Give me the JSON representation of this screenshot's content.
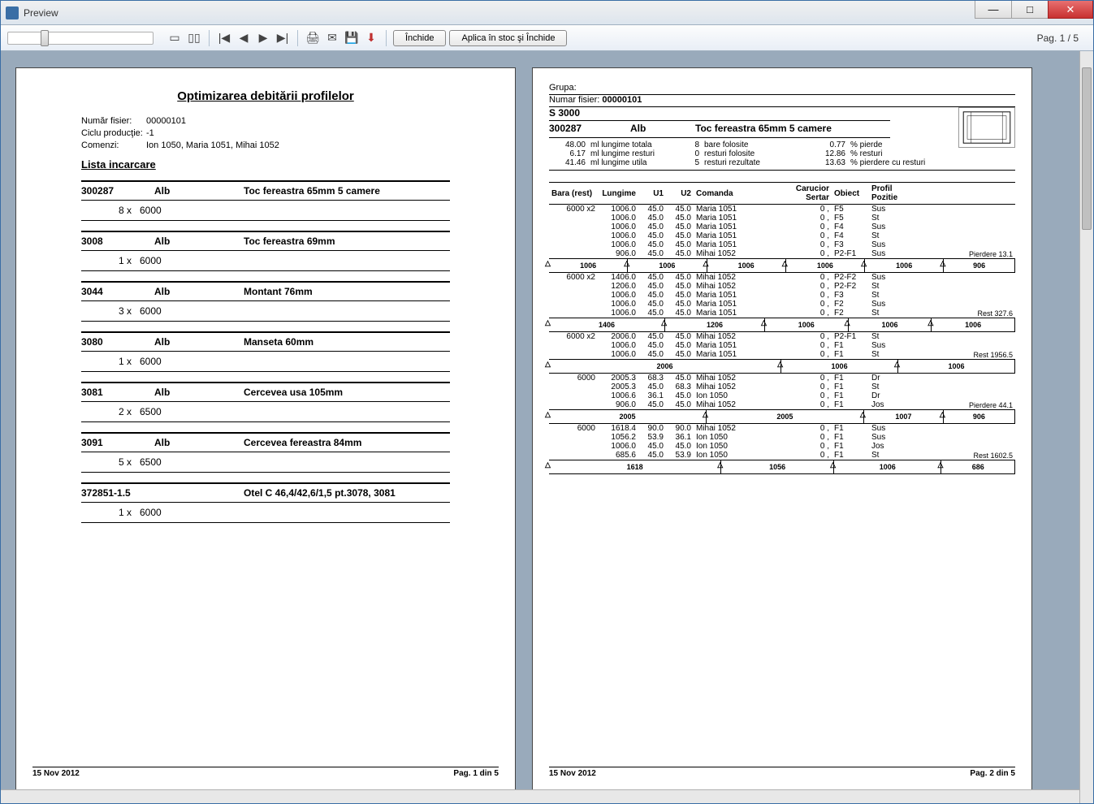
{
  "window": {
    "title": "Preview"
  },
  "toolbar": {
    "close_label": "Închide",
    "apply_label": "Aplica în stoc şi Închide",
    "page_indicator": "Pag. 1 / 5"
  },
  "page1": {
    "title": "Optimizarea debitării profilelor",
    "meta": {
      "file_label": "Număr fisier:",
      "file_value": "00000101",
      "cycle_label": "Ciclu producţie:",
      "cycle_value": "-1",
      "orders_label": "Comenzi:",
      "orders_value": "Ion 1050, Maria 1051, Mihai 1052"
    },
    "list_title": "Lista incarcare",
    "blocks": [
      {
        "code": "300287",
        "color": "Alb",
        "desc": "Toc fereastra 65mm 5 camere",
        "line": "8 x   6000"
      },
      {
        "code": "3008",
        "color": "Alb",
        "desc": "Toc fereastra 69mm",
        "line": "1 x   6000"
      },
      {
        "code": "3044",
        "color": "Alb",
        "desc": "Montant 76mm",
        "line": "3 x   6000"
      },
      {
        "code": "3080",
        "color": "Alb",
        "desc": "Manseta 60mm",
        "line": "1 x   6000"
      },
      {
        "code": "3081",
        "color": "Alb",
        "desc": "Cercevea usa 105mm",
        "line": "2 x   6500"
      },
      {
        "code": "3091",
        "color": "Alb",
        "desc": "Cercevea fereastra 84mm",
        "line": "5 x   6500"
      },
      {
        "code": "372851-1.5",
        "color": "",
        "desc": "Otel C 46,4/42,6/1,5 pt.3078, 3081",
        "line": "1 x   6000"
      }
    ],
    "footer_date": "15 Nov 2012",
    "footer_page": "Pag. 1 din 5"
  },
  "page2": {
    "grupa_label": "Grupa:",
    "file_label": "Numar fisier:",
    "file_value": "00000101",
    "model": "S 3000",
    "code": "300287",
    "color": "Alb",
    "desc": "Toc fereastra 65mm 5 camere",
    "summary": {
      "r1n1": "48.00",
      "r1t1": "ml lungime totala",
      "r1n2": "8",
      "r1t2": "bare folosite",
      "r1n3": "0.77",
      "r1t3": "% pierde",
      "r2n1": "6.17",
      "r2t1": "ml lungime resturi",
      "r2n2": "0",
      "r2t2": "resturi folosite",
      "r2n3": "12.86",
      "r2t3": "% resturi",
      "r3n1": "41.46",
      "r3t1": "ml lungime utila",
      "r3n2": "5",
      "r3t2": "resturi rezultate",
      "r3n3": "13.63",
      "r3t3": "% pierdere cu resturi"
    },
    "headers": {
      "bara": "Bara (rest)",
      "lungime": "Lungime",
      "u1": "U1",
      "u2": "U2",
      "comanda": "Comanda",
      "carucior": "Carucior",
      "sertar": "Sertar",
      "obiect": "Obiect",
      "profil": "Profil",
      "pozitie": "Pozitie"
    },
    "groups": [
      {
        "bar": "6000 x2",
        "rows": [
          {
            "len": "1006.0",
            "u1": "45.0",
            "u2": "45.0",
            "cmd": "Maria 1051",
            "sert": "0 ,",
            "obj": "F5",
            "poz": "Sus",
            "note": ""
          },
          {
            "len": "1006.0",
            "u1": "45.0",
            "u2": "45.0",
            "cmd": "Maria 1051",
            "sert": "0 ,",
            "obj": "F5",
            "poz": "St",
            "note": ""
          },
          {
            "len": "1006.0",
            "u1": "45.0",
            "u2": "45.0",
            "cmd": "Maria 1051",
            "sert": "0 ,",
            "obj": "F4",
            "poz": "Sus",
            "note": ""
          },
          {
            "len": "1006.0",
            "u1": "45.0",
            "u2": "45.0",
            "cmd": "Maria 1051",
            "sert": "0 ,",
            "obj": "F4",
            "poz": "St",
            "note": ""
          },
          {
            "len": "1006.0",
            "u1": "45.0",
            "u2": "45.0",
            "cmd": "Maria 1051",
            "sert": "0 ,",
            "obj": "F3",
            "poz": "Sus",
            "note": ""
          },
          {
            "len": "906.0",
            "u1": "45.0",
            "u2": "45.0",
            "cmd": "Mihai 1052",
            "sert": "0 ,",
            "obj": "P2-F1",
            "poz": "Sus",
            "note": "Pierdere   13.1"
          }
        ],
        "segments": [
          "1006",
          "1006",
          "1006",
          "1006",
          "1006",
          "906"
        ]
      },
      {
        "bar": "6000 x2",
        "rows": [
          {
            "len": "1406.0",
            "u1": "45.0",
            "u2": "45.0",
            "cmd": "Mihai 1052",
            "sert": "0 ,",
            "obj": "P2-F2",
            "poz": "Sus",
            "note": ""
          },
          {
            "len": "1206.0",
            "u1": "45.0",
            "u2": "45.0",
            "cmd": "Mihai 1052",
            "sert": "0 ,",
            "obj": "P2-F2",
            "poz": "St",
            "note": ""
          },
          {
            "len": "1006.0",
            "u1": "45.0",
            "u2": "45.0",
            "cmd": "Maria 1051",
            "sert": "0 ,",
            "obj": "F3",
            "poz": "St",
            "note": ""
          },
          {
            "len": "1006.0",
            "u1": "45.0",
            "u2": "45.0",
            "cmd": "Maria 1051",
            "sert": "0 ,",
            "obj": "F2",
            "poz": "Sus",
            "note": ""
          },
          {
            "len": "1006.0",
            "u1": "45.0",
            "u2": "45.0",
            "cmd": "Maria 1051",
            "sert": "0 ,",
            "obj": "F2",
            "poz": "St",
            "note": "Rest   327.6"
          }
        ],
        "segments": [
          "1406",
          "1206",
          "1006",
          "1006",
          "1006"
        ]
      },
      {
        "bar": "6000 x2",
        "rows": [
          {
            "len": "2006.0",
            "u1": "45.0",
            "u2": "45.0",
            "cmd": "Mihai 1052",
            "sert": "0 ,",
            "obj": "P2-F1",
            "poz": "St",
            "note": ""
          },
          {
            "len": "1006.0",
            "u1": "45.0",
            "u2": "45.0",
            "cmd": "Maria 1051",
            "sert": "0 ,",
            "obj": "F1",
            "poz": "Sus",
            "note": ""
          },
          {
            "len": "1006.0",
            "u1": "45.0",
            "u2": "45.0",
            "cmd": "Maria 1051",
            "sert": "0 ,",
            "obj": "F1",
            "poz": "St",
            "note": "Rest  1956.5"
          }
        ],
        "segments": [
          "2006",
          "1006",
          "1006"
        ]
      },
      {
        "bar": "6000",
        "rows": [
          {
            "len": "2005.3",
            "u1": "68.3",
            "u2": "45.0",
            "cmd": "Mihai 1052",
            "sert": "0 ,",
            "obj": "F1",
            "poz": "Dr",
            "note": ""
          },
          {
            "len": "2005.3",
            "u1": "45.0",
            "u2": "68.3",
            "cmd": "Mihai 1052",
            "sert": "0 ,",
            "obj": "F1",
            "poz": "St",
            "note": ""
          },
          {
            "len": "1006.6",
            "u1": "36.1",
            "u2": "45.0",
            "cmd": "Ion 1050",
            "sert": "0 ,",
            "obj": "F1",
            "poz": "Dr",
            "note": ""
          },
          {
            "len": "906.0",
            "u1": "45.0",
            "u2": "45.0",
            "cmd": "Mihai 1052",
            "sert": "0 ,",
            "obj": "F1",
            "poz": "Jos",
            "note": "Pierdere    44.1"
          }
        ],
        "segments": [
          "2005",
          "2005",
          "1007",
          "906"
        ]
      },
      {
        "bar": "6000",
        "rows": [
          {
            "len": "1618.4",
            "u1": "90.0",
            "u2": "90.0",
            "cmd": "Mihai 1052",
            "sert": "0 ,",
            "obj": "F1",
            "poz": "Sus",
            "note": ""
          },
          {
            "len": "1056.2",
            "u1": "53.9",
            "u2": "36.1",
            "cmd": "Ion 1050",
            "sert": "0 ,",
            "obj": "F1",
            "poz": "Sus",
            "note": ""
          },
          {
            "len": "1006.0",
            "u1": "45.0",
            "u2": "45.0",
            "cmd": "Ion 1050",
            "sert": "0 ,",
            "obj": "F1",
            "poz": "Jos",
            "note": ""
          },
          {
            "len": "685.6",
            "u1": "45.0",
            "u2": "53.9",
            "cmd": "Ion 1050",
            "sert": "0 ,",
            "obj": "F1",
            "poz": "St",
            "note": "Rest  1602.5"
          }
        ],
        "segments": [
          "1618",
          "1056",
          "1006",
          "686"
        ]
      }
    ],
    "footer_date": "15 Nov 2012",
    "footer_page": "Pag. 2 din 5"
  }
}
